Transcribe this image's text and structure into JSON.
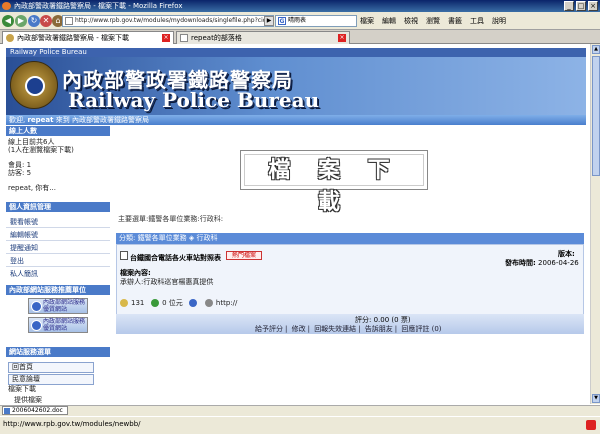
{
  "window": {
    "title": "內政部警政署鐵路警察局 - 檔案下載 - Mozilla Firefox",
    "min_label": "_",
    "max_label": "□",
    "close_label": "×"
  },
  "toolbar": {
    "back": "◀",
    "forward": "▶",
    "reload": "↻",
    "stop": "✕",
    "home": "⌂",
    "url": "http://www.rpb.gov.tw/modules/mydownloads/singlefile.php?cid=",
    "go": "▶",
    "search_value": "晴雨表"
  },
  "menu": [
    "檔案",
    "編輯",
    "檢視",
    "瀏覽",
    "書籤",
    "工具",
    "說明"
  ],
  "tabs": [
    {
      "label": "內政部警政署鐵路警察局 - 檔案下載",
      "active": true
    },
    {
      "label": "repeat的部落格",
      "active": false
    }
  ],
  "site": {
    "top_label": "Railway Police Bureau",
    "banner_cn": "內政部警政署鐵路警察局",
    "banner_en": "Railway Police Bureau",
    "welcome_pre": "歡迎,",
    "welcome_user": "repeat",
    "welcome_post": "來到 內政部警政署鐵路警察局"
  },
  "sidebar": {
    "online_header": "線上人數",
    "online_line1": "線上目前共6人",
    "online_line2": "(1人在瀏覽檔案下載)",
    "members": "會員: 1",
    "guests": "訪客: 5",
    "user_line": "repeat, 你有...",
    "personal_header": "個人資訊管理",
    "personal_items": [
      "觀看帳號",
      "編輯帳號",
      "提醒通知",
      "登出",
      "私人簡訊"
    ],
    "links_header": "內政部網站服務推薦單位",
    "link_buttons": [
      {
        "line1": "內政部網站服務",
        "line2": "優質網站"
      },
      {
        "line1": "內政部網站服務",
        "line2": "優質網站"
      }
    ],
    "menu_header": "網站服務選單",
    "menu_items": [
      "回首頁",
      "民意論壇",
      "檔案下載",
      "提供檔案"
    ]
  },
  "main": {
    "download_heading": "檔 案 下 載",
    "main_selection": "主要選單:鐵警各單位業務:行政科:",
    "category_label": "分類:",
    "category_path": "鐵警各單位業務",
    "category_sub": "行政科",
    "item_title": "台鐵國合電話各火車站對照表",
    "hot_badge": "熱門檔案",
    "version_label": "版本:",
    "pubdate_label": "發布時間:",
    "pubdate": "2006-04-26",
    "desc_label": "檔案內容:",
    "desc_text": "承辦人:行政科巡官楊惠真提供",
    "downloads": "131",
    "size": "0 位元",
    "homepage": "http://",
    "rating_label": "評分:",
    "rating_value": "0.00 (0 票)",
    "actions": [
      "給予評分",
      "修改",
      "回報失效連結",
      "告訴朋友",
      "回應評註 (0)"
    ]
  },
  "downloadbar": {
    "file": "2006042602.doc"
  },
  "statusbar": {
    "url": "http://www.rpb.gov.tw/modules/newbb/"
  }
}
